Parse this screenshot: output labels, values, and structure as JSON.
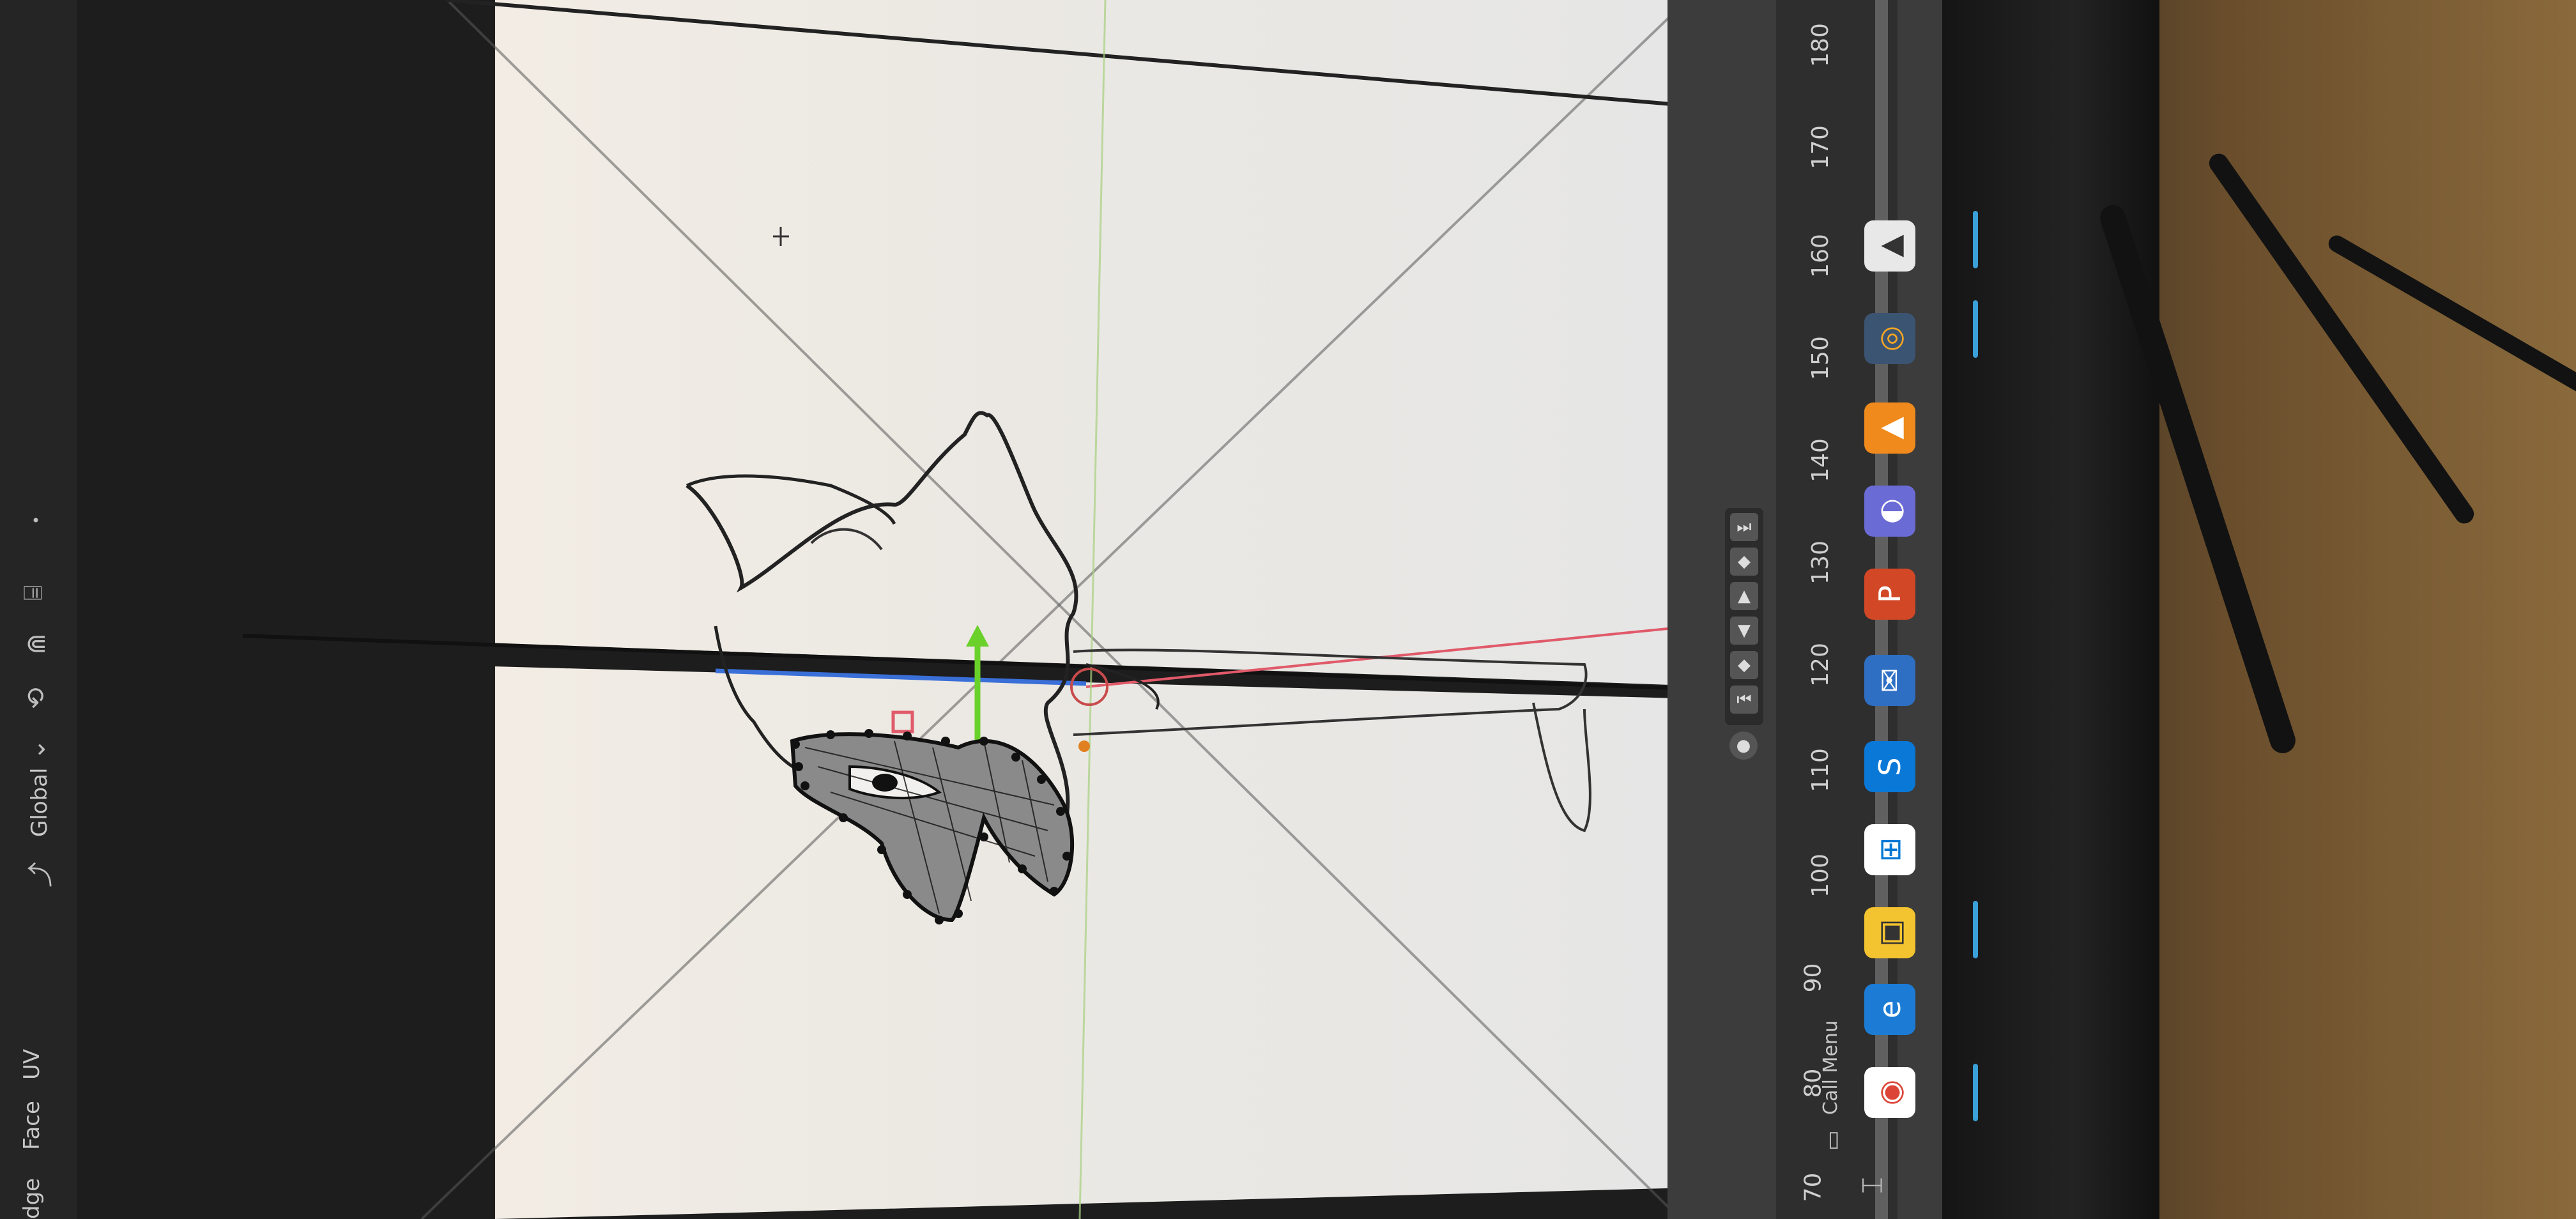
{
  "header": {
    "menu_items": [
      "dge",
      "Face",
      "UV"
    ],
    "orientation_label": "Global"
  },
  "timeline": {
    "frames": [
      "70",
      "80",
      "90",
      "100",
      "110",
      "120",
      "130",
      "140",
      "150",
      "160",
      "170",
      "180"
    ]
  },
  "statusbar": {
    "call_menu_label": "Call Menu"
  },
  "taskbar": {
    "icons": [
      "chrome-icon",
      "edge-icon",
      "file-explorer-icon",
      "store-icon",
      "skype-icon",
      "mail-icon",
      "powerpoint-icon",
      "paint-icon",
      "vlc-icon",
      "blender-icon",
      "photos-icon"
    ]
  },
  "colors": {
    "x_axis": "#e05a6a",
    "y_axis": "#3a6fd8",
    "z_axis": "#6ad02a",
    "viewport_bg": "#1d1d1d",
    "camera_plane": "#ece9e4",
    "accent": "#3aa0d8"
  }
}
